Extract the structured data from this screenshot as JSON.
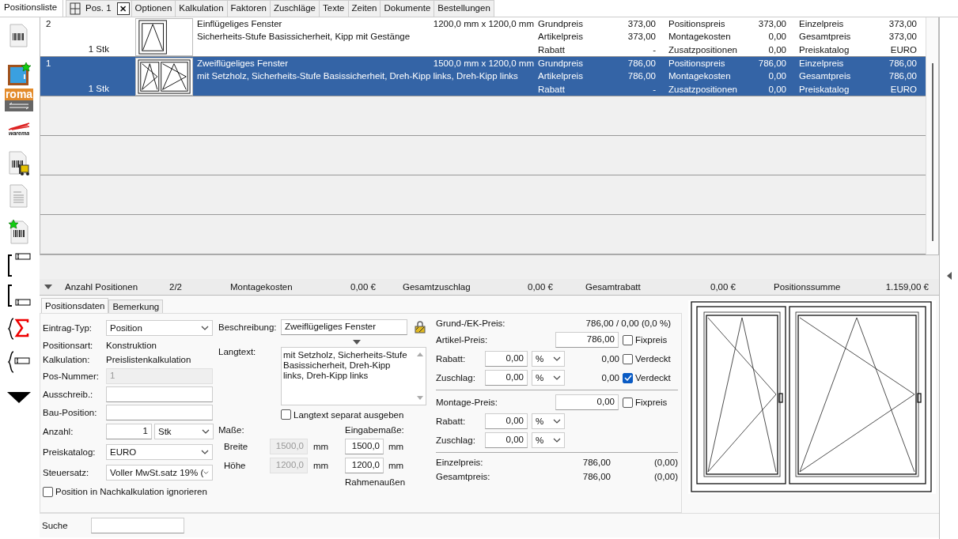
{
  "tabs": [
    {
      "label": "Positionsliste",
      "selected": true
    }
  ],
  "position_tab": {
    "label": "Pos. 1",
    "close": "✕"
  },
  "detail_tabs": [
    {
      "label": "Optionen",
      "selected": false
    },
    {
      "label": "Kalkulation",
      "selected": false
    },
    {
      "label": "Faktoren",
      "selected": false
    },
    {
      "label": "Zuschläge",
      "selected": false
    },
    {
      "label": "Texte",
      "selected": false
    },
    {
      "label": "Zeiten",
      "selected": false
    },
    {
      "label": "Dokumente",
      "selected": false
    },
    {
      "label": "Bestellungen",
      "selected": false
    }
  ],
  "sidebar_logos": [
    "roma",
    "warema"
  ],
  "positions": [
    {
      "number": "2",
      "quantity": "1 Stk",
      "kind": "single",
      "title": "Einflügeliges Fenster",
      "description": "Sicherheits-Stufe Basissicherheit, Kipp mit Gestänge",
      "dimensions": "1200,0 mm x 1200,0 mm",
      "selected": false,
      "prices": [
        {
          "label": "Grundpreis",
          "value": "373,00"
        },
        {
          "label": "Artikelpreis",
          "value": "373,00"
        },
        {
          "label": "Rabatt",
          "value": "-"
        },
        {
          "label": "Positionspreis",
          "value": "373,00"
        },
        {
          "label": "Montagekosten",
          "value": "0,00"
        },
        {
          "label": "Zusatzpositionen",
          "value": "0,00"
        },
        {
          "label": "Einzelpreis",
          "value": "373,00"
        },
        {
          "label": "Gesamtpreis",
          "value": "373,00"
        },
        {
          "label": "Preiskatalog",
          "value": "EURO"
        }
      ]
    },
    {
      "number": "1",
      "quantity": "1 Stk",
      "kind": "double",
      "title": "Zweiflügeliges Fenster",
      "description": "mit Setzholz, Sicherheits-Stufe Basissicherheit, Dreh-Kipp links, Dreh-Kipp links",
      "dimensions": "1500,0 mm x 1200,0 mm",
      "selected": true,
      "prices": [
        {
          "label": "Grundpreis",
          "value": "786,00"
        },
        {
          "label": "Artikelpreis",
          "value": "786,00"
        },
        {
          "label": "Rabatt",
          "value": "-"
        },
        {
          "label": "Positionspreis",
          "value": "786,00"
        },
        {
          "label": "Montagekosten",
          "value": "0,00"
        },
        {
          "label": "Zusatzpositionen",
          "value": "0,00"
        },
        {
          "label": "Einzelpreis",
          "value": "786,00"
        },
        {
          "label": "Gesamtpreis",
          "value": "786,00"
        },
        {
          "label": "Preiskatalog",
          "value": "EURO"
        }
      ]
    }
  ],
  "summary": {
    "expanded": true,
    "items": [
      {
        "label": "Anzahl Positionen",
        "value": "2/2"
      },
      {
        "label": "Montagekosten",
        "value": "0,00 €"
      },
      {
        "label": "Gesamtzuschlag",
        "value": "0,00 €"
      },
      {
        "label": "Gesamtrabatt",
        "value": "0,00 €"
      },
      {
        "label": "Positionssumme",
        "value": "1.159,00 €"
      }
    ]
  },
  "form": {
    "tabs": [
      {
        "label": "Positionsdaten",
        "selected": true
      },
      {
        "label": "Bemerkung",
        "selected": false
      }
    ],
    "general": [
      {
        "kind": "dropdown",
        "label": "Eintrag-Typ:",
        "value": "Position"
      },
      {
        "kind": "info",
        "label": "Positionsart:",
        "value": "Konstruktion"
      },
      {
        "kind": "info",
        "label": "Kalkulation:",
        "value": "Preislistenkalkulation"
      },
      {
        "kind": "input",
        "label": "Pos-Nummer:",
        "value": "1",
        "disabled": true
      },
      {
        "kind": "input",
        "label": "Ausschreib.:",
        "disabled": false
      },
      {
        "kind": "input",
        "label": "Bau-Position:",
        "disabled": false
      },
      {
        "kind": "quantity",
        "label": "Anzahl:",
        "value": "1",
        "unit": "Stk"
      },
      {
        "kind": "dropdown",
        "label": "Preiskatalog:",
        "value": "EURO"
      },
      {
        "kind": "dropdown",
        "label": "Steuersatz:",
        "value": "Voller MwSt.satz 19% ("
      },
      {
        "kind": "checkbox",
        "label": "Position in Nachkalkulation ignorieren",
        "checked": false
      }
    ],
    "description": {
      "label": "Beschreibung:",
      "value": "Zweiflügeliges Fenster"
    },
    "long_text": {
      "label": "Langtext:",
      "value": "mit Setzholz, Sicherheits-Stufe Basissicherheit, Dreh-Kipp links, Dreh-Kipp links"
    },
    "separate_output": {
      "label": "Langtext separat ausgeben",
      "checked": false
    },
    "dimensions": {
      "label": "Maße:",
      "input_label": "Eingabemaße:",
      "note": "Rahmenaußen",
      "rows": [
        {
          "label": "Breite",
          "value": "1500,0",
          "unit": "mm",
          "input": "1500,0",
          "input_unit": "mm"
        },
        {
          "label": "Höhe",
          "value": "1200,0",
          "unit": "mm",
          "input": "1200,0",
          "input_unit": "mm"
        }
      ]
    },
    "pricing": [
      {
        "kind": "info",
        "label": "Grund-/EK-Preis:",
        "value": "786,00 / 0,00 (0,0 %)"
      },
      {
        "kind": "price",
        "label": "Artikel-Preis:",
        "value": "786,00",
        "checkbox": {
          "label": "Fixpreis",
          "checked": false
        }
      },
      {
        "kind": "adjust",
        "label": "Rabatt:",
        "value": "0,00",
        "unit": "%",
        "result": "0,00",
        "checkbox": {
          "label": "Verdeckt",
          "checked": false
        }
      },
      {
        "kind": "adjust",
        "label": "Zuschlag:",
        "value": "0,00",
        "unit": "%",
        "result": "0,00",
        "checkbox": {
          "label": "Verdeckt",
          "checked": true
        }
      },
      {
        "kind": "divider"
      },
      {
        "kind": "price",
        "label": "Montage-Preis:",
        "value": "0,00",
        "checkbox": {
          "label": "Fixpreis",
          "checked": false
        }
      },
      {
        "kind": "adjust",
        "label": "Rabatt:",
        "value": "0,00",
        "unit": "%"
      },
      {
        "kind": "adjust",
        "label": "Zuschlag:",
        "value": "0,00",
        "unit": "%"
      },
      {
        "kind": "divider"
      },
      {
        "kind": "total",
        "label": "Einzelpreis:",
        "value": "786,00",
        "extra": "(0,00)"
      },
      {
        "kind": "total",
        "label": "Gesamtpreis:",
        "value": "786,00",
        "extra": "(0,00)"
      }
    ]
  },
  "search": {
    "label": "Suche"
  }
}
